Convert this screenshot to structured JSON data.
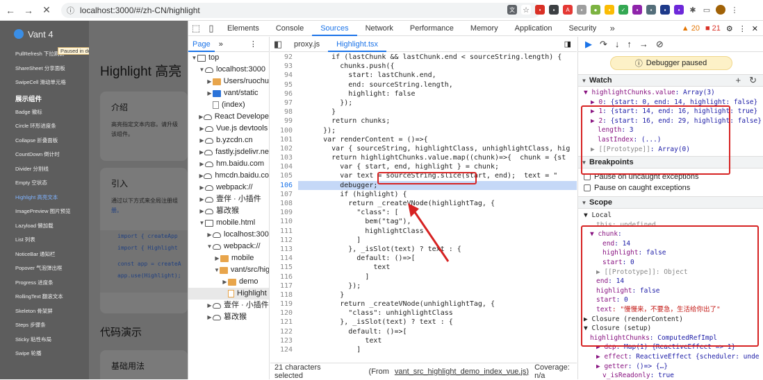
{
  "browser": {
    "url": "localhost:3000/#/zh-CN/highlight"
  },
  "page": {
    "logo": "Vant 4",
    "paused_badge": "Paused in debugger",
    "sidebar_top": [
      "PullRefresh 下拉刷新",
      "ShareSheet 分享面板",
      "SwipeCell 滑动单元格"
    ],
    "group_label": "展示组件",
    "sidebar_items": [
      "Badge 徽标",
      "Circle 环形进度条",
      "Collapse 折叠面板",
      "CountDown 倒计时",
      "Divider 分割线",
      "Empty 空状态",
      "Highlight 高亮文本",
      "ImagePreview 图片预览",
      "Lazyload 懒加载",
      "List 列表",
      "NoticeBar 通知栏",
      "Popover 气泡弹出框",
      "Progress 进度条",
      "RollingText 翻滚文本",
      "Skeleton 骨架屏",
      "Steps 步骤条",
      "Sticky 粘性布局",
      "Swipe 轮播"
    ],
    "title": "Highlight 高亮",
    "intro_title": "介绍",
    "intro_text": [
      "高亮指定文本内容。请升级",
      "该组件。"
    ],
    "usage_title": "引入",
    "usage_text": [
      "通过以下方式来全局注册组",
      "册。"
    ],
    "code_lines": [
      "import { createApp",
      "import { Highlight",
      "",
      "const app = createA",
      "app.use(Highlight);"
    ],
    "demo_title": "代码演示",
    "basic_title": "基础用法"
  },
  "devtools": {
    "tabs": [
      "Elements",
      "Console",
      "Sources",
      "Network",
      "Performance",
      "Memory",
      "Application",
      "Security"
    ],
    "selected_tab": "Sources",
    "warnings": "20",
    "errors": "21",
    "navigator_tab": "Page",
    "tree": [
      {
        "label": "top",
        "indent": 0,
        "icon": "top",
        "open": "▼"
      },
      {
        "label": "localhost:3000",
        "indent": 1,
        "icon": "cloud",
        "open": "▼"
      },
      {
        "label": "Users/ruochu",
        "indent": 2,
        "icon": "folder",
        "open": "▶"
      },
      {
        "label": "vant/static",
        "indent": 2,
        "icon": "folderb",
        "open": "▶"
      },
      {
        "label": "(index)",
        "indent": 2,
        "icon": "file",
        "open": ""
      },
      {
        "label": "React Develope",
        "indent": 1,
        "icon": "cloud",
        "open": "▶"
      },
      {
        "label": "Vue.js devtools",
        "indent": 1,
        "icon": "cloud",
        "open": "▶"
      },
      {
        "label": "b.yzcdn.cn",
        "indent": 1,
        "icon": "cloud",
        "open": "▶"
      },
      {
        "label": "fastly.jsdelivr.ne",
        "indent": 1,
        "icon": "cloud",
        "open": "▶"
      },
      {
        "label": "hm.baidu.com",
        "indent": 1,
        "icon": "cloud",
        "open": "▶"
      },
      {
        "label": "hmcdn.baidu.co",
        "indent": 1,
        "icon": "cloud",
        "open": "▶"
      },
      {
        "label": "webpack://",
        "indent": 1,
        "icon": "cloud",
        "open": "▶"
      },
      {
        "label": "壹伴 · 小插件",
        "indent": 1,
        "icon": "cloud",
        "open": "▶"
      },
      {
        "label": "篡改猴",
        "indent": 1,
        "icon": "cloud",
        "open": "▶"
      },
      {
        "label": "mobile.html",
        "indent": 1,
        "icon": "top",
        "open": "▼"
      },
      {
        "label": "localhost:300",
        "indent": 2,
        "icon": "cloud",
        "open": "▶"
      },
      {
        "label": "webpack://",
        "indent": 2,
        "icon": "cloud",
        "open": "▼"
      },
      {
        "label": "mobile",
        "indent": 3,
        "icon": "folder",
        "open": "▶"
      },
      {
        "label": "vant/src/hig",
        "indent": 3,
        "icon": "folder",
        "open": "▼"
      },
      {
        "label": "demo",
        "indent": 4,
        "icon": "folder",
        "open": "▶"
      },
      {
        "label": "Highlight",
        "indent": 4,
        "icon": "fileo",
        "open": "",
        "sel": true
      },
      {
        "label": "壹伴 · 小插件",
        "indent": 2,
        "icon": "cloud",
        "open": "▶"
      },
      {
        "label": "篡改猴",
        "indent": 2,
        "icon": "cloud",
        "open": "▶"
      }
    ],
    "editor_tabs": [
      "proxy.js",
      "Highlight.tsx"
    ],
    "selected_editor_tab": "Highlight.tsx",
    "code": [
      {
        "n": "92",
        "t": "        if (lastChunk && lastChunk.end < sourceString.length) {"
      },
      {
        "n": "93",
        "t": "          chunks.push({"
      },
      {
        "n": "94",
        "t": "            start: lastChunk.end,"
      },
      {
        "n": "95",
        "t": "            end: sourceString.length,"
      },
      {
        "n": "96",
        "t": "            highlight: false"
      },
      {
        "n": "97",
        "t": "          });"
      },
      {
        "n": "98",
        "t": "        }"
      },
      {
        "n": "99",
        "t": "        return chunks;"
      },
      {
        "n": "100",
        "t": "      });"
      },
      {
        "n": "101",
        "t": "      var renderContent = ()=>{"
      },
      {
        "n": "102",
        "t": "        var { sourceString, highlightClass, unhighlightClass, hig"
      },
      {
        "n": "103",
        "t": "        return highlightChunks.value.map((chunk)=>{  chunk = {st"
      },
      {
        "n": "104",
        "t": "          var { start, end, highlight } = chunk;"
      },
      {
        "n": "105",
        "t": "          var text = sourceString.slice(start, end);  text = \""
      },
      {
        "n": "106",
        "t": "          debugger;",
        "cur": true
      },
      {
        "n": "107",
        "t": "          if (highlight) {"
      },
      {
        "n": "108",
        "t": "            return _createVNode(highlightTag, {"
      },
      {
        "n": "109",
        "t": "              \"class\": ["
      },
      {
        "n": "110",
        "t": "                bem(\"tag\"),"
      },
      {
        "n": "111",
        "t": "                highlightClass"
      },
      {
        "n": "112",
        "t": "              ]"
      },
      {
        "n": "113",
        "t": "            }, _isSlot(text) ? text : {"
      },
      {
        "n": "114",
        "t": "              default: ()=>["
      },
      {
        "n": "115",
        "t": "                  text"
      },
      {
        "n": "116",
        "t": "                ]"
      },
      {
        "n": "117",
        "t": "            });"
      },
      {
        "n": "118",
        "t": "          }"
      },
      {
        "n": "119",
        "t": "          return _createVNode(unhighlightTag, {"
      },
      {
        "n": "120",
        "t": "            \"class\": unhighlightClass"
      },
      {
        "n": "121",
        "t": "          }, _isSlot(text) ? text : {"
      },
      {
        "n": "122",
        "t": "            default: ()=>["
      },
      {
        "n": "123",
        "t": "                text"
      },
      {
        "n": "124",
        "t": "              ]"
      }
    ],
    "status_selected": "21 characters selected",
    "status_from": "(From",
    "status_file": "vant_src_highlight_demo_index_vue.js)",
    "status_coverage": "Coverage: n/a",
    "paused_msg": "Debugger paused",
    "watch_title": "Watch",
    "watch": [
      {
        "p": 0,
        "k": "▼ highlightChunks.value",
        "v": ": Array(3)"
      },
      {
        "p": 1,
        "k": "▶ 0",
        "v": ": {start: 0, end: 14, highlight: false}"
      },
      {
        "p": 1,
        "k": "▶ 1",
        "v": ": {start: 14, end: 16, highlight: true}"
      },
      {
        "p": 1,
        "k": "▶ 2",
        "v": ": {start: 16, end: 29, highlight: false}"
      },
      {
        "p": 2,
        "k": "length",
        "v": ": 3"
      },
      {
        "p": 2,
        "k": "lastIndex",
        "v": ": (...)"
      },
      {
        "p": 1,
        "k": "▶ [[Prototype]]",
        "v": ": Array(0)"
      }
    ],
    "breakpoints_title": "Breakpoints",
    "bp_uncaught": "Pause on uncaught exceptions",
    "bp_caught": "Pause on caught exceptions",
    "scope_title": "Scope",
    "scope": [
      {
        "p": 0,
        "k": "▼ Local",
        "v": "",
        "plain": true
      },
      {
        "p": 2,
        "k": "this",
        "v": ": undefined",
        "grey": true
      },
      {
        "p": 1,
        "k": "▼ chunk",
        "v": ":"
      },
      {
        "p": 3,
        "k": "end",
        "v": ": 14"
      },
      {
        "p": 3,
        "k": "highlight",
        "v": ": false"
      },
      {
        "p": 3,
        "k": "start",
        "v": ": 0"
      },
      {
        "p": 2,
        "k": "▶ [[Prototype]]",
        "v": ": Object",
        "grey": true
      },
      {
        "p": 2,
        "k": "end",
        "v": ": 14"
      },
      {
        "p": 2,
        "k": "highlight",
        "v": ": false"
      },
      {
        "p": 2,
        "k": "start",
        "v": ": 0"
      },
      {
        "p": 2,
        "k": "text",
        "v": ": \"慢慢来，不要急，生活给你出了\"",
        "str": true
      },
      {
        "p": 0,
        "k": "▶ Closure (renderContent)",
        "v": "",
        "plain": true
      },
      {
        "p": 0,
        "k": "▼ Closure (setup)",
        "v": "",
        "plain": true
      },
      {
        "p": 1,
        "k": "highlightChunks",
        "v": ": ComputedRefImpl"
      },
      {
        "p": 2,
        "k": "▶ dep",
        "v": ": Map(1) {ReactiveEffect => 1}"
      },
      {
        "p": 2,
        "k": "▶ effect",
        "v": ": ReactiveEffect {scheduler: unde"
      },
      {
        "p": 2,
        "k": "▶ getter",
        "v": ": ()=> {…}"
      },
      {
        "p": 3,
        "k": "v_isReadonly",
        "v": ": true"
      }
    ]
  }
}
